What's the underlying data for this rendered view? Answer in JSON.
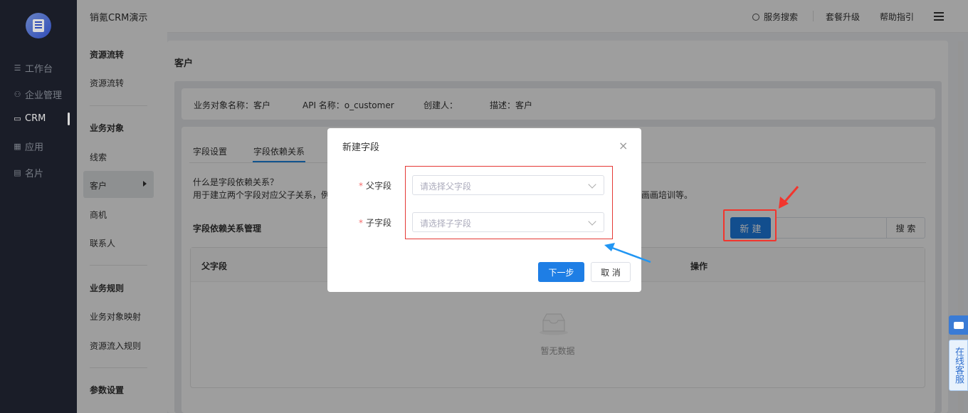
{
  "app": {
    "title": "销氪CRM演示"
  },
  "left_nav": {
    "items": [
      {
        "label": "工作台",
        "icon": "workbench-icon"
      },
      {
        "label": "企业管理",
        "icon": "org-icon"
      },
      {
        "label": "CRM",
        "icon": "crm-icon"
      },
      {
        "label": "应用",
        "icon": "apps-icon"
      },
      {
        "label": "名片",
        "icon": "card-icon"
      }
    ],
    "active": "CRM"
  },
  "sub_nav": {
    "h1": "资源流转",
    "i1": "资源流转",
    "h2": "业务对象",
    "i2": "线索",
    "i3": "客户",
    "i4": "商机",
    "i5": "联系人",
    "h3": "业务规则",
    "i6": "业务对象映射",
    "i7": "资源流入规则",
    "h4": "参数设置"
  },
  "topbar": {
    "search": "服务搜索",
    "upgrade": "套餐升级",
    "help": "帮助指引"
  },
  "page": {
    "title": "客户"
  },
  "info": {
    "name": "业务对象名称：客户",
    "api": "API 名称：o_customer",
    "creator": "创建人：",
    "desc": "描述：客户"
  },
  "tabs": {
    "t1": "字段设置",
    "t2": "字段依赖关系",
    "active": "字段依赖关系"
  },
  "description": {
    "q": "什么是字段依赖关系？",
    "line_left": "用于建立两个字段对应父子关系，例",
    "line_right": "画画培训等。"
  },
  "section": {
    "title": "字段依赖关系管理",
    "new_btn": "新 建",
    "search_btn": "搜 索"
  },
  "table": {
    "col_parent": "父字段",
    "col_action": "操作",
    "empty": "暂无数据"
  },
  "modal": {
    "title": "新建字段",
    "close": "×",
    "parent_label": "父字段",
    "parent_placeholder": "请选择父字段",
    "child_label": "子字段",
    "child_placeholder": "请选择子字段",
    "next": "下一步",
    "cancel": "取 消"
  },
  "float": {
    "service": "在线客服"
  },
  "colors": {
    "primary": "#1e7ee5",
    "highlight": "#f2352d",
    "sidebar": "#1f2330"
  }
}
